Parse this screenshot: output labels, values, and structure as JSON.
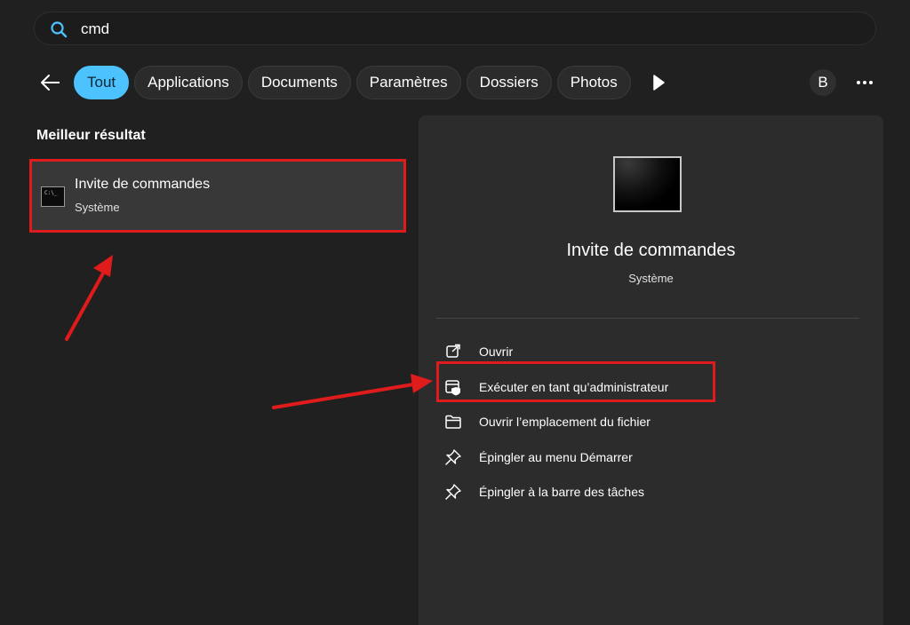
{
  "search": {
    "value": "cmd"
  },
  "filters": {
    "tabs": [
      {
        "label": "Tout",
        "active": true
      },
      {
        "label": "Applications",
        "active": false
      },
      {
        "label": "Documents",
        "active": false
      },
      {
        "label": "Paramètres",
        "active": false
      },
      {
        "label": "Dossiers",
        "active": false
      },
      {
        "label": "Photos",
        "active": false
      }
    ],
    "avatar_initial": "B"
  },
  "results": {
    "section_title": "Meilleur résultat",
    "best": {
      "title": "Invite de commandes",
      "subtitle": "Système",
      "icon_text": "C:\\_"
    }
  },
  "detail": {
    "title": "Invite de commandes",
    "subtitle": "Système",
    "actions": [
      {
        "label": "Ouvrir",
        "icon": "open-external-icon"
      },
      {
        "label": "Exécuter en tant qu’administrateur",
        "icon": "run-as-admin-icon"
      },
      {
        "label": "Ouvrir l’emplacement du fichier",
        "icon": "folder-icon"
      },
      {
        "label": "Épingler au menu Démarrer",
        "icon": "pin-icon"
      },
      {
        "label": "Épingler à la barre des tâches",
        "icon": "pin-icon"
      }
    ]
  },
  "colors": {
    "accent": "#4cc2ff",
    "annotation_red": "#e01b1b",
    "background": "#202020",
    "panel": "#2c2c2c"
  }
}
